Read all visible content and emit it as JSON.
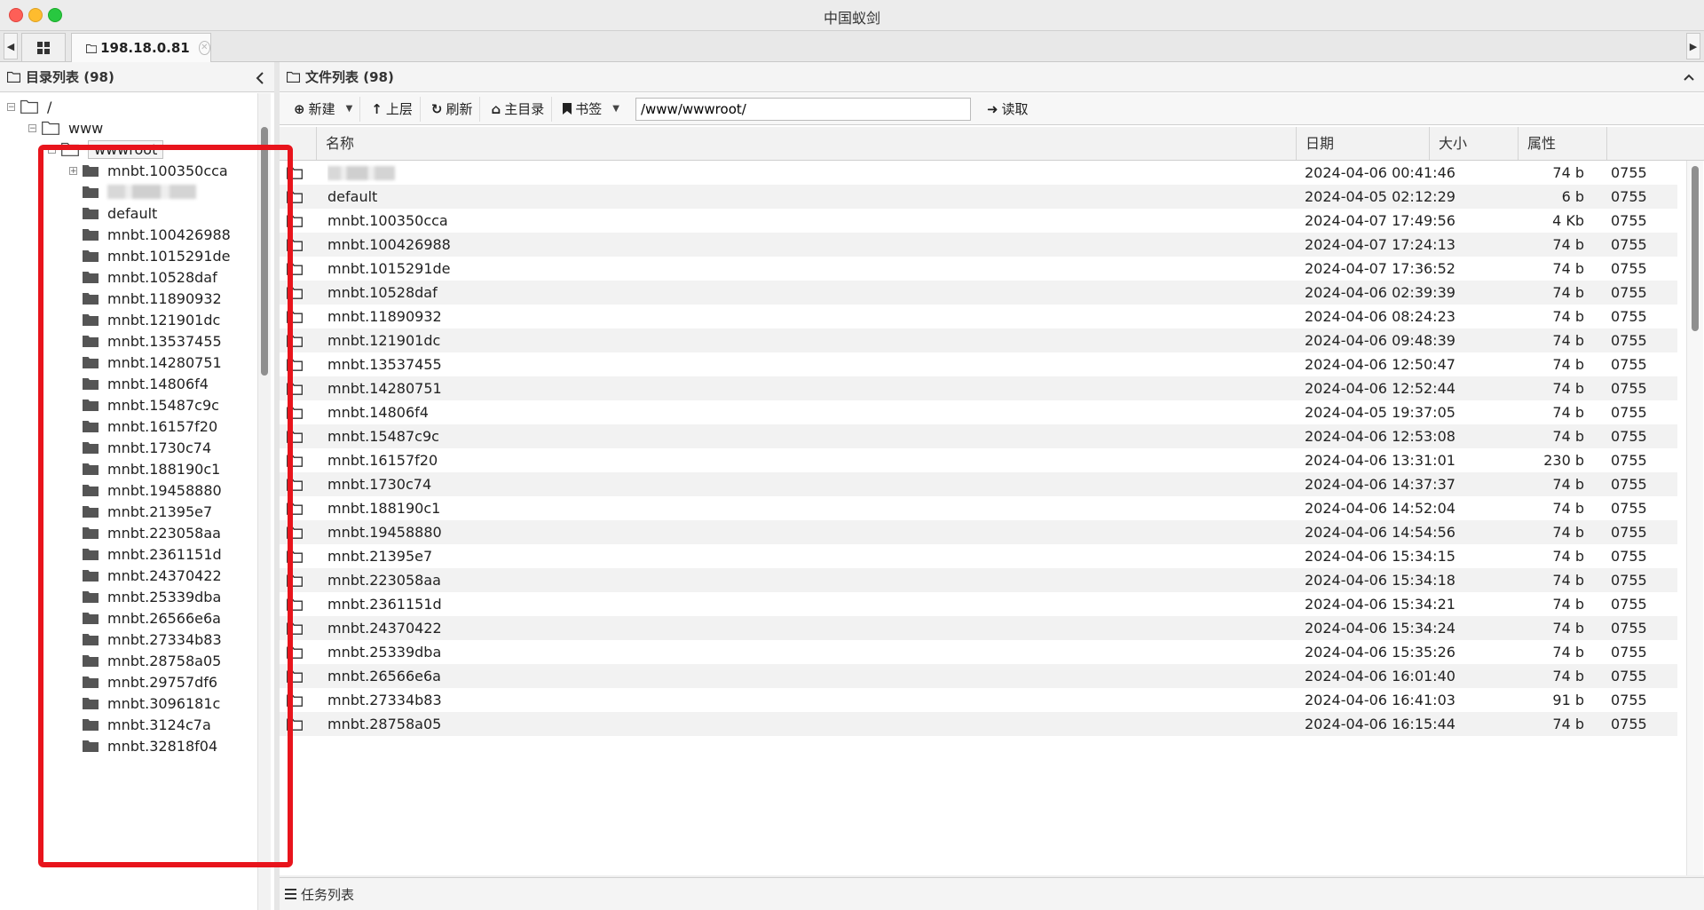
{
  "window": {
    "title": "中国蚁剑"
  },
  "tabs": {
    "active_label": "198.18.0.81"
  },
  "left_panel": {
    "title": "目录列表 (98)",
    "tree": [
      {
        "label": "/",
        "level": 0,
        "expander": "minus",
        "kind": "open"
      },
      {
        "label": "www",
        "level": 1,
        "expander": "minus",
        "kind": "open"
      },
      {
        "label": "wwwroot",
        "level": 2,
        "expander": "minus",
        "kind": "open",
        "selected": true
      },
      {
        "label": "mnbt.100350cca",
        "level": 3,
        "expander": "plus",
        "kind": "closed"
      },
      {
        "label": "",
        "level": 3,
        "expander": "none",
        "kind": "closed",
        "blurred": true
      },
      {
        "label": "default",
        "level": 3,
        "expander": "none",
        "kind": "closed"
      },
      {
        "label": "mnbt.100426988",
        "level": 3,
        "expander": "none",
        "kind": "closed"
      },
      {
        "label": "mnbt.1015291de",
        "level": 3,
        "expander": "none",
        "kind": "closed"
      },
      {
        "label": "mnbt.10528daf",
        "level": 3,
        "expander": "none",
        "kind": "closed"
      },
      {
        "label": "mnbt.11890932",
        "level": 3,
        "expander": "none",
        "kind": "closed"
      },
      {
        "label": "mnbt.121901dc",
        "level": 3,
        "expander": "none",
        "kind": "closed"
      },
      {
        "label": "mnbt.13537455",
        "level": 3,
        "expander": "none",
        "kind": "closed"
      },
      {
        "label": "mnbt.14280751",
        "level": 3,
        "expander": "none",
        "kind": "closed"
      },
      {
        "label": "mnbt.14806f4",
        "level": 3,
        "expander": "none",
        "kind": "closed"
      },
      {
        "label": "mnbt.15487c9c",
        "level": 3,
        "expander": "none",
        "kind": "closed"
      },
      {
        "label": "mnbt.16157f20",
        "level": 3,
        "expander": "none",
        "kind": "closed"
      },
      {
        "label": "mnbt.1730c74",
        "level": 3,
        "expander": "none",
        "kind": "closed"
      },
      {
        "label": "mnbt.188190c1",
        "level": 3,
        "expander": "none",
        "kind": "closed"
      },
      {
        "label": "mnbt.19458880",
        "level": 3,
        "expander": "none",
        "kind": "closed"
      },
      {
        "label": "mnbt.21395e7",
        "level": 3,
        "expander": "none",
        "kind": "closed"
      },
      {
        "label": "mnbt.223058aa",
        "level": 3,
        "expander": "none",
        "kind": "closed"
      },
      {
        "label": "mnbt.2361151d",
        "level": 3,
        "expander": "none",
        "kind": "closed"
      },
      {
        "label": "mnbt.24370422",
        "level": 3,
        "expander": "none",
        "kind": "closed"
      },
      {
        "label": "mnbt.25339dba",
        "level": 3,
        "expander": "none",
        "kind": "closed"
      },
      {
        "label": "mnbt.26566e6a",
        "level": 3,
        "expander": "none",
        "kind": "closed"
      },
      {
        "label": "mnbt.27334b83",
        "level": 3,
        "expander": "none",
        "kind": "closed"
      },
      {
        "label": "mnbt.28758a05",
        "level": 3,
        "expander": "none",
        "kind": "closed"
      },
      {
        "label": "mnbt.29757df6",
        "level": 3,
        "expander": "none",
        "kind": "closed"
      },
      {
        "label": "mnbt.3096181c",
        "level": 3,
        "expander": "none",
        "kind": "closed"
      },
      {
        "label": "mnbt.3124c7a",
        "level": 3,
        "expander": "none",
        "kind": "closed"
      },
      {
        "label": "mnbt.32818f04",
        "level": 3,
        "expander": "none",
        "kind": "closed"
      }
    ]
  },
  "right_panel": {
    "title": "文件列表 (98)",
    "toolbar": {
      "new_label": "新建",
      "up_label": "上层",
      "refresh_label": "刷新",
      "home_label": "主目录",
      "bookmark_label": "书签",
      "path_value": "/www/wwwroot/",
      "read_label": "读取"
    },
    "columns": {
      "name": "名称",
      "date": "日期",
      "size": "大小",
      "attr": "属性"
    },
    "rows": [
      {
        "name": "",
        "blurred": true,
        "date": "2024-04-06 00:41:46",
        "size": "74 b",
        "attr": "0755"
      },
      {
        "name": "default",
        "date": "2024-04-05 02:12:29",
        "size": "6 b",
        "attr": "0755"
      },
      {
        "name": "mnbt.100350cca",
        "date": "2024-04-07 17:49:56",
        "size": "4 Kb",
        "attr": "0755"
      },
      {
        "name": "mnbt.100426988",
        "date": "2024-04-07 17:24:13",
        "size": "74 b",
        "attr": "0755"
      },
      {
        "name": "mnbt.1015291de",
        "date": "2024-04-07 17:36:52",
        "size": "74 b",
        "attr": "0755"
      },
      {
        "name": "mnbt.10528daf",
        "date": "2024-04-06 02:39:39",
        "size": "74 b",
        "attr": "0755"
      },
      {
        "name": "mnbt.11890932",
        "date": "2024-04-06 08:24:23",
        "size": "74 b",
        "attr": "0755"
      },
      {
        "name": "mnbt.121901dc",
        "date": "2024-04-06 09:48:39",
        "size": "74 b",
        "attr": "0755"
      },
      {
        "name": "mnbt.13537455",
        "date": "2024-04-06 12:50:47",
        "size": "74 b",
        "attr": "0755"
      },
      {
        "name": "mnbt.14280751",
        "date": "2024-04-06 12:52:44",
        "size": "74 b",
        "attr": "0755"
      },
      {
        "name": "mnbt.14806f4",
        "date": "2024-04-05 19:37:05",
        "size": "74 b",
        "attr": "0755"
      },
      {
        "name": "mnbt.15487c9c",
        "date": "2024-04-06 12:53:08",
        "size": "74 b",
        "attr": "0755"
      },
      {
        "name": "mnbt.16157f20",
        "date": "2024-04-06 13:31:01",
        "size": "230 b",
        "attr": "0755"
      },
      {
        "name": "mnbt.1730c74",
        "date": "2024-04-06 14:37:37",
        "size": "74 b",
        "attr": "0755"
      },
      {
        "name": "mnbt.188190c1",
        "date": "2024-04-06 14:52:04",
        "size": "74 b",
        "attr": "0755"
      },
      {
        "name": "mnbt.19458880",
        "date": "2024-04-06 14:54:56",
        "size": "74 b",
        "attr": "0755"
      },
      {
        "name": "mnbt.21395e7",
        "date": "2024-04-06 15:34:15",
        "size": "74 b",
        "attr": "0755"
      },
      {
        "name": "mnbt.223058aa",
        "date": "2024-04-06 15:34:18",
        "size": "74 b",
        "attr": "0755"
      },
      {
        "name": "mnbt.2361151d",
        "date": "2024-04-06 15:34:21",
        "size": "74 b",
        "attr": "0755"
      },
      {
        "name": "mnbt.24370422",
        "date": "2024-04-06 15:34:24",
        "size": "74 b",
        "attr": "0755"
      },
      {
        "name": "mnbt.25339dba",
        "date": "2024-04-06 15:35:26",
        "size": "74 b",
        "attr": "0755"
      },
      {
        "name": "mnbt.26566e6a",
        "date": "2024-04-06 16:01:40",
        "size": "74 b",
        "attr": "0755"
      },
      {
        "name": "mnbt.27334b83",
        "date": "2024-04-06 16:41:03",
        "size": "91 b",
        "attr": "0755"
      },
      {
        "name": "mnbt.28758a05",
        "date": "2024-04-06 16:15:44",
        "size": "74 b",
        "attr": "0755"
      }
    ]
  },
  "task_panel": {
    "title": "任务列表"
  },
  "colors": {
    "highlight_box": "#e8141c",
    "folder_fill": "#555555",
    "alt_row": "#f2f2f2"
  },
  "icons": [
    "grid-icon",
    "folder-outline-icon",
    "folder-solid-icon",
    "plus-circle-icon",
    "arrow-up-icon",
    "refresh-icon",
    "home-icon",
    "bookmark-icon",
    "arrow-right-icon",
    "tasks-icon",
    "chevron-left-icon",
    "chevron-up-icon",
    "close-circle-icon"
  ]
}
